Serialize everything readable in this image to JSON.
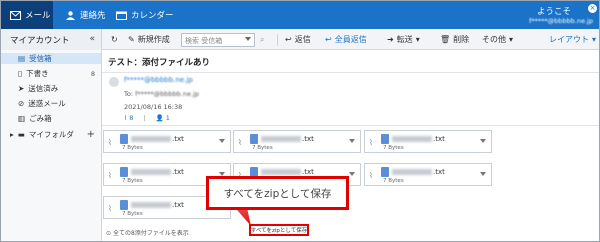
{
  "topbar": {
    "mail": "メール",
    "contacts": "連絡先",
    "calendar": "カレンダー",
    "welcome": "ようこそ",
    "account": "f*****@bbbbb.ne.jp"
  },
  "toolbar": {
    "sidebar_title": "マイアカウント",
    "new_label": "新規作成",
    "search_placeholder": "検索 受信箱",
    "reply": "返信",
    "reply_all": "全員返信",
    "forward": "転送",
    "delete": "削除",
    "other": "その他",
    "layout": "レイアウト"
  },
  "sidebar": {
    "items": [
      {
        "label": "受信箱"
      },
      {
        "label": "下書き",
        "count": "8"
      },
      {
        "label": "送信済み"
      },
      {
        "label": "迷惑メール"
      },
      {
        "label": "ごみ箱"
      },
      {
        "label": "マイフォルダ"
      }
    ]
  },
  "message": {
    "subject": "テスト：添付ファイルあり",
    "from": "f*****@bbbbb.ne.jp",
    "to_label": "To:",
    "to": "f*****@bbbbb.ne.jp",
    "date": "2021/08/16 16:38",
    "attach_count": "8",
    "person_count": "1"
  },
  "attachments": [
    {
      "ext": ".txt",
      "size": "7 Bytes"
    },
    {
      "ext": ".txt",
      "size": "7 Bytes"
    },
    {
      "ext": ".txt",
      "size": "7 Bytes"
    },
    {
      "ext": ".txt",
      "size": "7 Bytes"
    },
    {
      "ext": ".txt",
      "size": "7 Bytes"
    },
    {
      "ext": ".txt",
      "size": "7 Bytes"
    },
    {
      "ext": ".txt",
      "size": "7 Bytes"
    }
  ],
  "footer": {
    "show_all": "全ての8添付ファイルを表示",
    "zip_small": "すべてをzipとして保存"
  },
  "callout": {
    "text": "すべてをzipとして保存"
  },
  "colors": {
    "brand": "#1b73c9",
    "highlight": "#e10000"
  }
}
